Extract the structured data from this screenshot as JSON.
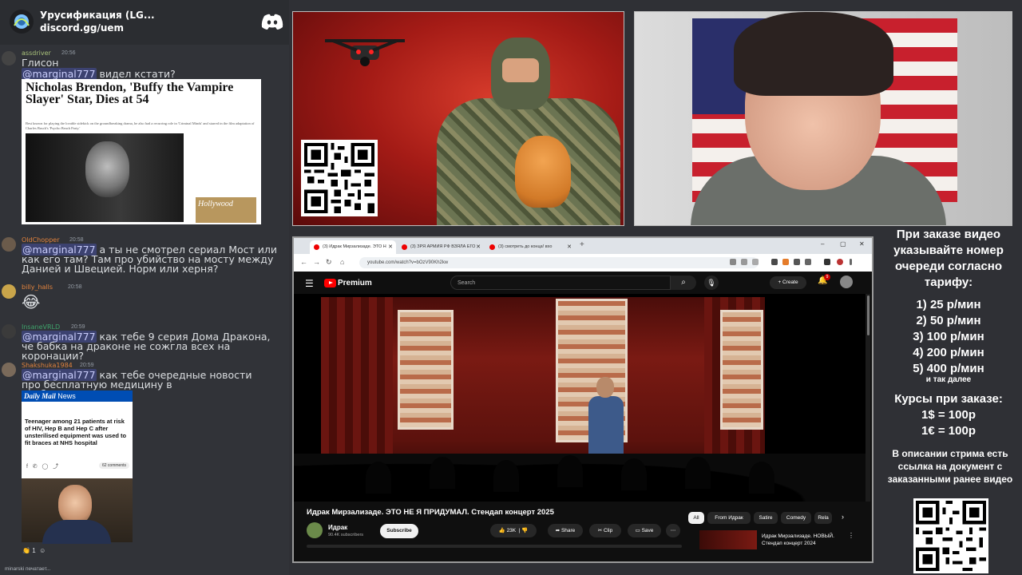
{
  "server": {
    "title": "Урусификация (LG...",
    "invite": "discord.gg/uem"
  },
  "messages": [
    {
      "user": "assdriver",
      "time": "20:56",
      "line1": "Глисон",
      "mention": "@marginal777",
      "rest": " видел кстати?",
      "user_color": "#a8c07a"
    },
    {
      "user": "OldChopper",
      "time": "20:58",
      "mention": "@marginal777",
      "rest": " а ты не смотрел сериал Мост или как его там? Там про убийство на мосту между Данией и Швецией. Норм или херня?",
      "user_color": "#e0823d"
    },
    {
      "user": "billy_halls",
      "time": "20:58",
      "emoji": "😂",
      "user_color": "#e0823d"
    },
    {
      "user": "InsaneVRLD",
      "time": "20:59",
      "mention": "@marginal777",
      "rest": " как тебе 9 серия Дома Дракона, че бабка на драконе не сожгла всех на коронации?",
      "user_color": "#3fa36b"
    },
    {
      "user": "Shakshuka1984",
      "time": "20:59",
      "mention": "@marginal777",
      "rest": " как тебе очередные новости про бесплатную медицину в альбиономатрасии?",
      "user_color": "#e0823d"
    }
  ],
  "embed_hr": {
    "headline": "Nicholas Brendon, 'Buffy the Vampire Slayer' Star, Dies at 54",
    "summary": "Best known for playing the lovable sidekick on the groundbreaking drama, he also had a recurring role in 'Criminal Minds' and starred in the film adaptation of Charles Busch's 'Psycho Beach Party.'",
    "magazine": "Hollywood"
  },
  "embed_dm": {
    "brand": "Daily Mail",
    "section": "News",
    "headline": "Teenager among 21 patients at risk of HIV, Hep B and Hep C after unsterilised equipment was used to fit braces at NHS hospital",
    "comments": "62 comments"
  },
  "reaction": {
    "emoji": "👏",
    "count": "1"
  },
  "typing": "minarski печатает...",
  "browser": {
    "tabs": [
      "(3) Идрак Мирзализаде. ЭТО Н",
      "(3) ЗРЯ АРМИЯ РФ ВЗЯЛА ЕГО",
      "(3) смотреть до конца! вхо"
    ],
    "url": "youtube.com/watch?v=bOzV90Kh2kw"
  },
  "youtube": {
    "brand": "Premium",
    "search_placeholder": "Search",
    "create_label": "Create",
    "notifications": "9",
    "video_title": "Идрак Мирзализаде. ЭТО НЕ Я ПРИДУМАЛ. Стендап концерт 2025",
    "channel": "Идрак",
    "subscribers": "90.4K subscribers",
    "subscribe": "Subscribe",
    "likes": "23K",
    "share": "Share",
    "clip": "Clip",
    "save": "Save",
    "chips": [
      "All",
      "From Идрак",
      "Satire",
      "Comedy",
      "Rela"
    ],
    "rec_title": "Идрак Мирзализаде. НОВЫЙ. Стендап концерт 2024"
  },
  "info": {
    "intro": "При заказе видео указывайте номер очереди согласно тарифу:",
    "tariffs": [
      "1) 25 р/мин",
      "2) 50 р/мин",
      "3) 100 р/мин",
      "4) 200 р/мин",
      "5) 400 р/мин"
    ],
    "etc": "и так далее",
    "rates_title": "Курсы при заказе:",
    "rate1": "1$ = 100р",
    "rate2": "1€ = 100р",
    "description": "В описании стрима есть ссылка на документ с заказанными ранее видео"
  },
  "colors": {
    "discord_bg": "#313338",
    "mention_bg": "#3c4270",
    "youtube_red": "#ff0000",
    "panel_bg": "#2f3035"
  }
}
